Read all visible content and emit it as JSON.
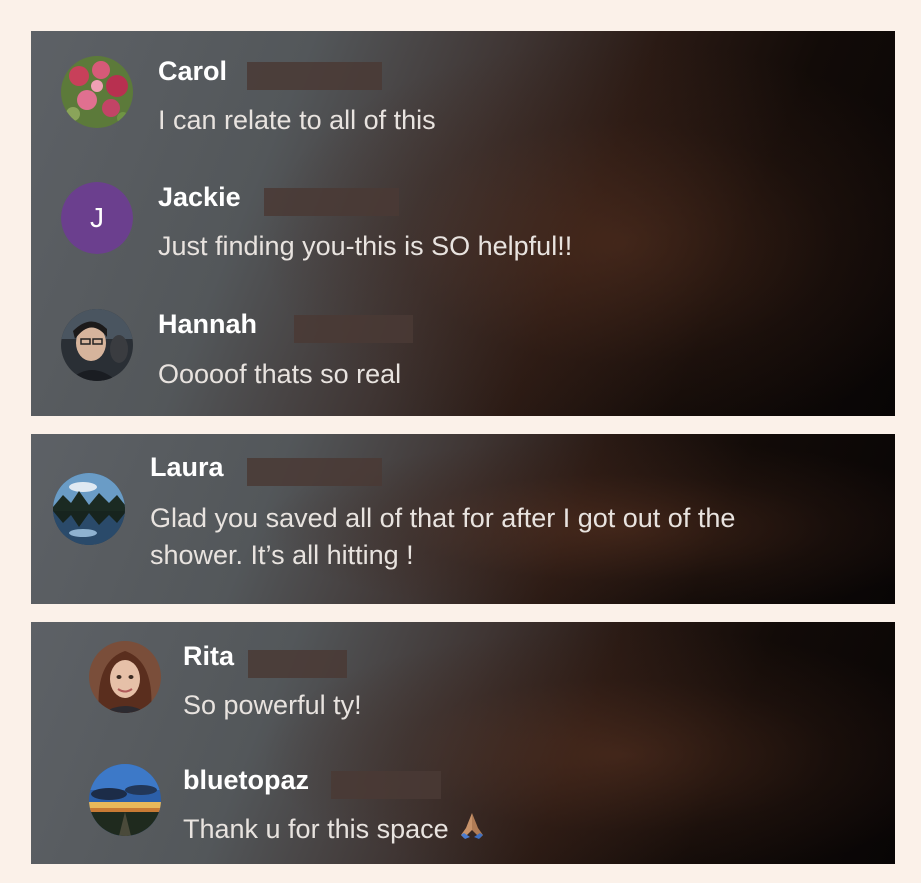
{
  "comments_group_1": [
    {
      "name": "Carol",
      "text": "I can relate to all of this",
      "avatar": "flowers-photo"
    },
    {
      "name": "Jackie",
      "text": "Just finding you-this is SO helpful!!",
      "avatar_initial": "J",
      "avatar_color": "#6b3f8e"
    },
    {
      "name": "Hannah",
      "text": "Ooooof thats so real",
      "avatar": "selfie-photo"
    }
  ],
  "comments_group_2": [
    {
      "name": "Laura",
      "text_line1": "Glad you saved all of that for after I got out of the",
      "text_line2": "shower. It’s all hitting !",
      "avatar": "lake-photo"
    }
  ],
  "comments_group_3": [
    {
      "name": "Rita",
      "text": "So powerful ty!",
      "avatar": "portrait-photo"
    },
    {
      "name": "bluetopaz",
      "text": "Thank u for this space",
      "emoji": "folded-hands-icon",
      "avatar": "sky-photo"
    }
  ],
  "colors": {
    "page_background": "#fbf1e9",
    "panel_dark": "#080505",
    "panel_gray": "#5d6166",
    "name_text": "#ffffff",
    "comment_text": "#e8e3df"
  }
}
